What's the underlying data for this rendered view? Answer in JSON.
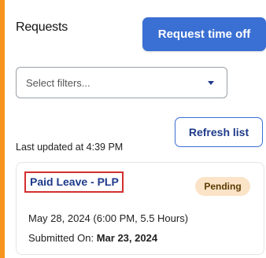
{
  "header": {
    "title": "Requests",
    "request_button": "Request time off"
  },
  "filters": {
    "placeholder": "Select filters..."
  },
  "refresh": {
    "label": "Refresh list",
    "last_updated": "Last updated at 4:39 PM"
  },
  "request_card": {
    "type": "Paid Leave - PLP",
    "status": "Pending",
    "dates": "May 28, 2024 (6:00 PM, 5.5 Hours)",
    "submitted_label": "Submitted On:",
    "submitted_date": "Mar 23, 2024"
  },
  "colors": {
    "background": "#f7941d",
    "primary": "#3a6fd3",
    "link": "#1e3a8a",
    "highlight_box": "#d32f2f",
    "badge_bg": "#fbe3c7"
  }
}
